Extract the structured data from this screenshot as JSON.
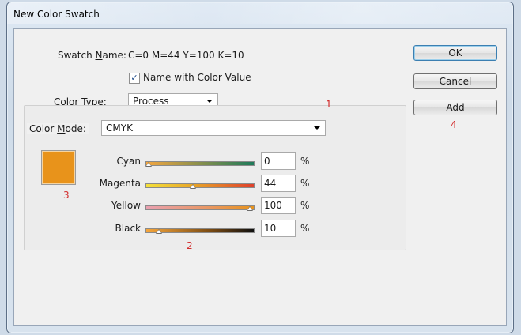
{
  "window": {
    "title": "New Color Swatch"
  },
  "swatch_name": {
    "label": "Swatch Name:",
    "value": "C=0 M=44 Y=100 K=10"
  },
  "name_with_color_value": {
    "label": "Name with Color Value",
    "checked": true
  },
  "color_type": {
    "label": "Color Type:",
    "value": "Process"
  },
  "color_mode": {
    "label": "Color Mode:",
    "value": "CMYK"
  },
  "swatch_color": "#e8931b",
  "sliders": [
    {
      "label": "Cyan",
      "value": "0",
      "unit": "%",
      "fraction": 0.0,
      "track": "linear-gradient(90deg,#f3a640,#1e7a5a)"
    },
    {
      "label": "Magenta",
      "value": "44",
      "unit": "%",
      "fraction": 0.44,
      "track": "linear-gradient(90deg,#f4e03a,#e7a328 45%,#e0402c)"
    },
    {
      "label": "Yellow",
      "value": "100",
      "unit": "%",
      "fraction": 1.0,
      "track": "linear-gradient(90deg,#e9a0b0,#e99760 60%,#e8931b)"
    },
    {
      "label": "Black",
      "value": "10",
      "unit": "%",
      "fraction": 0.1,
      "track": "linear-gradient(90deg,#f6a63b,#7a4a12 60%,#101010)"
    }
  ],
  "buttons": {
    "ok": "OK",
    "cancel": "Cancel",
    "add": "Add"
  },
  "annotations": {
    "n1": "1",
    "n2": "2",
    "n3": "3",
    "n4": "4"
  }
}
